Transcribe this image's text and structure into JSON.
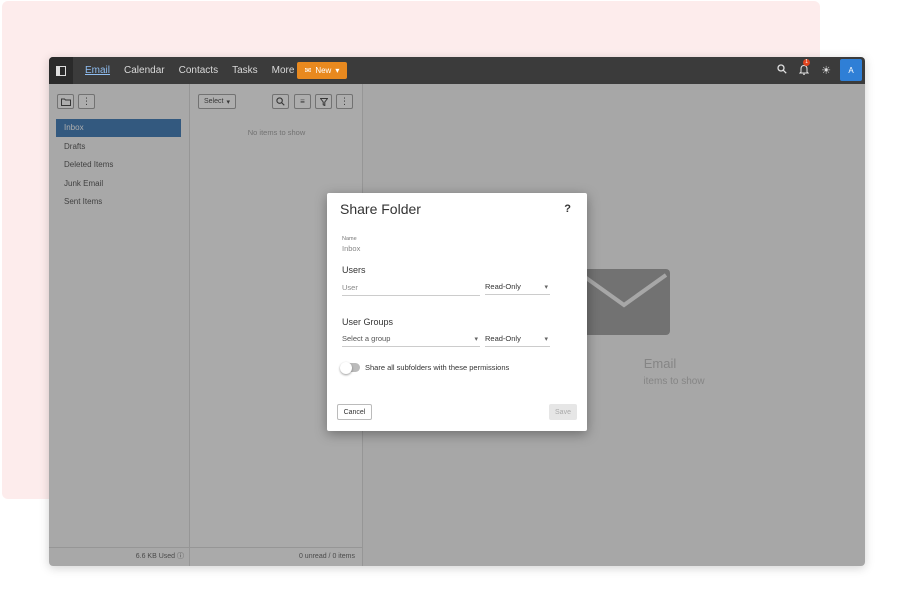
{
  "topbar": {
    "nav": [
      "Email",
      "Calendar",
      "Contacts",
      "Tasks",
      "More ▾"
    ],
    "new_label": "New",
    "notification_count": "1",
    "avatar_initial": "A"
  },
  "folders": {
    "items": [
      "Inbox",
      "Drafts",
      "Deleted Items",
      "Junk Email",
      "Sent Items"
    ],
    "active": "Inbox",
    "storage": "6.6 KB Used"
  },
  "list": {
    "select_label": "Select",
    "empty_text": "No items to show",
    "status": "0 unread / 0 items"
  },
  "reading": {
    "title": "Email",
    "subtitle": "items to show"
  },
  "dialog": {
    "title": "Share Folder",
    "help": "?",
    "name_label": "Name",
    "name_value": "Inbox",
    "users_heading": "Users",
    "user_placeholder": "User",
    "user_permission": "Read-Only",
    "groups_heading": "User Groups",
    "group_placeholder": "Select a group",
    "group_permission": "Read-Only",
    "subfolders_label": "Share all subfolders with these permissions",
    "subfolders_on": false,
    "cancel_label": "Cancel",
    "save_label": "Save"
  },
  "colors": {
    "topbar": "#3b3b3b",
    "accent_new": "#e8891f",
    "active_folder": "#2d6fb0",
    "avatar": "#2f7fd6",
    "backdrop_pink": "#fdecec"
  }
}
